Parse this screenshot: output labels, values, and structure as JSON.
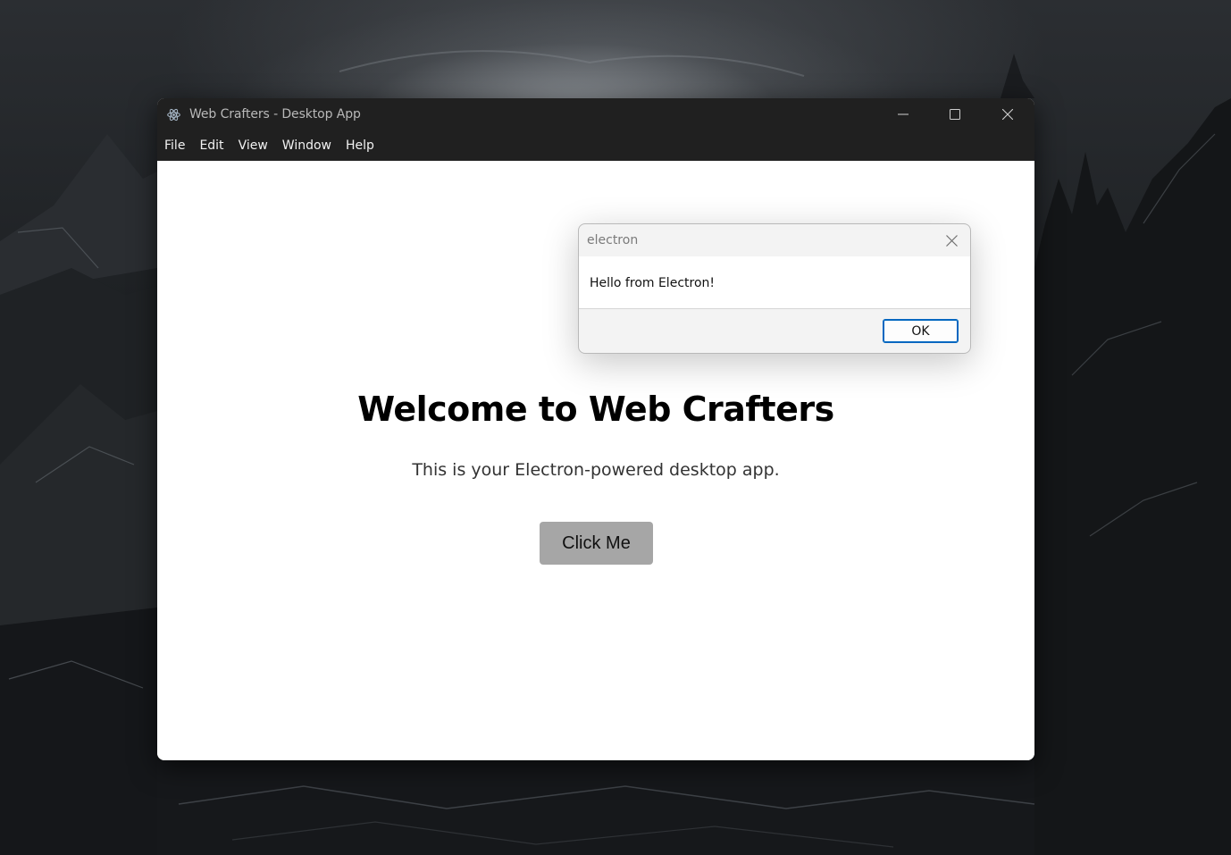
{
  "window": {
    "title": "Web Crafters - Desktop App",
    "menu": [
      "File",
      "Edit",
      "View",
      "Window",
      "Help"
    ]
  },
  "page": {
    "heading": "Welcome to Web Crafters",
    "subtitle": "This is your Electron-powered desktop app.",
    "button_label": "Click Me"
  },
  "dialog": {
    "title": "electron",
    "message": "Hello from Electron!",
    "ok_label": "OK"
  },
  "colors": {
    "title_bar": "#202020",
    "dialog_button_border": "#0067c0",
    "page_button_bg": "#a6a6a6"
  }
}
